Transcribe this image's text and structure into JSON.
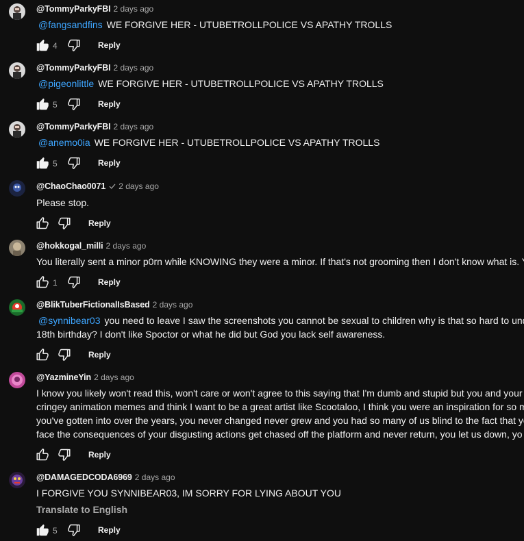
{
  "comments": [
    {
      "author": "@TommyParkyFBI",
      "time": "2 days ago",
      "mention": "@fangsandfins",
      "text": "WE FORGIVE HER - UTUBETROLLPOLICE VS APATHY TROLLS",
      "likes": "4",
      "reply_label": "Reply",
      "liked": true
    },
    {
      "author": "@TommyParkyFBI",
      "time": "2 days ago",
      "mention": "@pigeonlittle",
      "text": "WE FORGIVE HER - UTUBETROLLPOLICE VS APATHY TROLLS",
      "likes": "5",
      "reply_label": "Reply",
      "liked": true
    },
    {
      "author": "@TommyParkyFBI",
      "time": "2 days ago",
      "mention": "@anemo0ia",
      "text": "WE FORGIVE HER - UTUBETROLLPOLICE VS APATHY TROLLS",
      "likes": "5",
      "reply_label": "Reply",
      "liked": true
    },
    {
      "author": "@ChaoChao0071",
      "time": "2 days ago",
      "verified": true,
      "text": "Please stop.",
      "likes": "",
      "reply_label": "Reply",
      "liked": false
    },
    {
      "author": "@hokkogal_milli",
      "time": "2 days ago",
      "text": "You literally sent a minor p0rn while KNOWING they were a minor. If that's not grooming then I don't know what is. Y",
      "likes": "1",
      "reply_label": "Reply",
      "liked": false
    },
    {
      "author": "@BlikTuberFictionalIsBased",
      "time": "2 days ago",
      "mention": "@synnibear03",
      "text_lines": [
        "you need to leave I saw the screenshots you cannot be sexual to children why is that so hard to und",
        "18th birthday? I don't like Spoctor or what he did but God you lack self awareness."
      ],
      "likes": "",
      "reply_label": "Reply",
      "liked": false
    },
    {
      "author": "@YazmineYin",
      "time": "2 days ago",
      "text_lines": [
        "I know you likely won't read this, won't care or won't agree to this saying that I'm dumb and stupid but you and your c",
        "cringey animation memes and think I want to be a great artist like Scootaloo, I think you were an inspiration for so m",
        "you've gotten into over the years, you never changed  never grew and you had so many of us blind to the fact that yo",
        "face the consequences of your disgusting actions  get chased off the platform and never return, you let us down, yo"
      ],
      "likes": "",
      "reply_label": "Reply",
      "liked": false
    },
    {
      "author": "@DAMAGEDCODA6969",
      "time": "2 days ago",
      "text": "I FORGIVE YOU SYNNIBEAR03, IM SORRY FOR LYING ABOUT YOU",
      "translate_label": "Translate to English",
      "likes": "5",
      "reply_label": "Reply",
      "liked": true
    }
  ],
  "icons": {
    "like": "thumb-up-icon",
    "dislike": "thumb-down-icon",
    "verified": "check-icon"
  },
  "colors": {
    "background": "#0f0f0f",
    "text": "#f1f1f1",
    "secondary": "#aaaaaa",
    "link": "#3ea6ff"
  }
}
